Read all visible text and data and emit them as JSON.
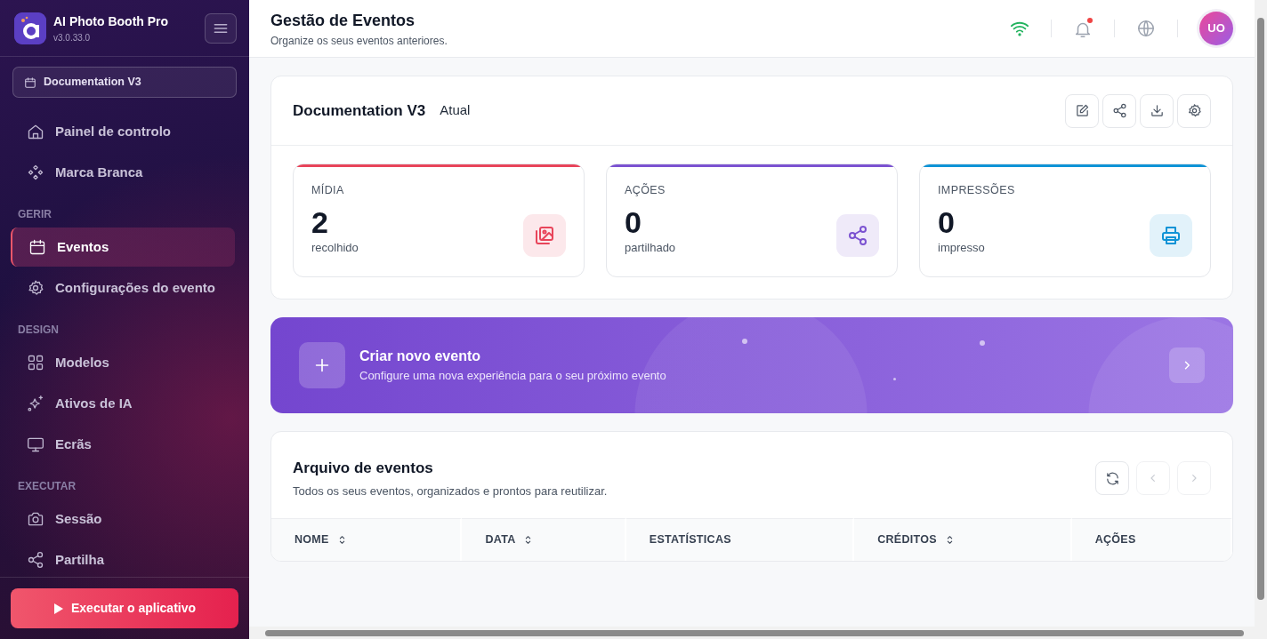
{
  "app": {
    "name": "AI Photo Booth Pro",
    "version": "v3.0.33.0"
  },
  "event_selector": {
    "label": "Documentation V3"
  },
  "nav": [
    {
      "items": [
        {
          "label": "Painel de controlo",
          "kind": "home",
          "selected": false
        },
        {
          "label": "Marca Branca",
          "kind": "diamonds",
          "selected": false
        }
      ]
    },
    {
      "heading": "GERIR",
      "items": [
        {
          "label": "Eventos",
          "kind": "calendar",
          "selected": true
        },
        {
          "label": "Configurações do evento",
          "kind": "gear",
          "selected": false
        }
      ]
    },
    {
      "heading": "DESIGN",
      "items": [
        {
          "label": "Modelos",
          "kind": "grid",
          "selected": false
        },
        {
          "label": "Ativos de IA",
          "kind": "sparkle",
          "selected": false
        },
        {
          "label": "Ecrãs",
          "kind": "monitor",
          "selected": false
        }
      ]
    },
    {
      "heading": "EXECUTAR",
      "items": [
        {
          "label": "Sessão",
          "kind": "camera",
          "selected": false
        },
        {
          "label": "Partilha",
          "kind": "share",
          "selected": false
        }
      ]
    }
  ],
  "run_button": {
    "label": "Executar o aplicativo"
  },
  "header": {
    "title": "Gestão de Eventos",
    "subtitle": "Organize os seus eventos anteriores.",
    "notification": true,
    "avatar": "UO"
  },
  "event_card": {
    "title": "Documentation V3",
    "status": "Atual",
    "stats": [
      {
        "label": "MÍDIA",
        "value": "2",
        "caption": "recolhido",
        "color": "#e8445a",
        "kind": "images"
      },
      {
        "label": "AÇÕES",
        "value": "0",
        "caption": "partilhado",
        "color": "#7b52d1",
        "kind": "share"
      },
      {
        "label": "IMPRESSÕES",
        "value": "0",
        "caption": "impresso",
        "color": "#0e93d6",
        "kind": "printer"
      }
    ]
  },
  "create_banner": {
    "title": "Criar novo evento",
    "subtitle": "Configure uma nova experiência para o seu próximo evento"
  },
  "archive": {
    "title": "Arquivo de eventos",
    "subtitle": "Todos os seus eventos, organizados e prontos para reutilizar.",
    "prev_disabled": true,
    "next_disabled": true,
    "columns": [
      {
        "label": "NOME",
        "sortable": true
      },
      {
        "label": "DATA",
        "sortable": true
      },
      {
        "label": "ESTATÍSTICAS",
        "sortable": false
      },
      {
        "label": "CRÉDITOS",
        "sortable": true
      },
      {
        "label": "AÇÕES",
        "sortable": false
      }
    ]
  }
}
